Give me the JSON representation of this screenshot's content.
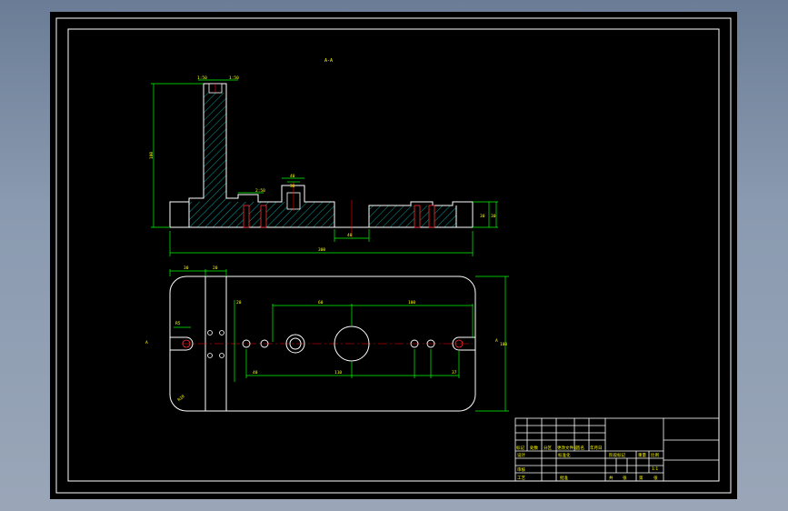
{
  "drawing": {
    "section_label": "A-A",
    "colors": {
      "background": "#000000",
      "frame": "#ffffff",
      "outline": "#ffffff",
      "dimension": "#00ff00",
      "hatch": "#00a0a0",
      "center_line": "#ff0000",
      "text": "#ffff00"
    },
    "section_dims": {
      "top_left": "1:50",
      "top_right": "1:50",
      "height": "100",
      "bore_width": "40",
      "bore_inner": "30",
      "slot": "2:50",
      "base_thickness_1": "30",
      "base_thickness_2": "30",
      "center_hole": "40",
      "overall_length": "300"
    },
    "plan_dims": {
      "left_1": "30",
      "left_2": "20",
      "slot_radius": "R5",
      "hole_spacing": "20",
      "mid_left": "60",
      "mid_right": "100",
      "bottom_1": "40",
      "bottom_center": "110",
      "bottom_right": "37",
      "width": "100",
      "corner": "R10",
      "view_mark_left": "A",
      "view_mark_right": "A"
    },
    "title_block": {
      "labels": [
        "标记",
        "处数",
        "分区",
        "更改文件号",
        "签名",
        "年月日"
      ],
      "row_design": "设计",
      "row_review": "审核",
      "row_process": "工艺",
      "row_approve": "批准",
      "standard": "标准化",
      "stage_mark": "阶段标记",
      "weight": "重量",
      "scale": "比例",
      "scale_value": "1:1",
      "sheet_labels": [
        "共",
        "张",
        "第",
        "张"
      ]
    }
  }
}
